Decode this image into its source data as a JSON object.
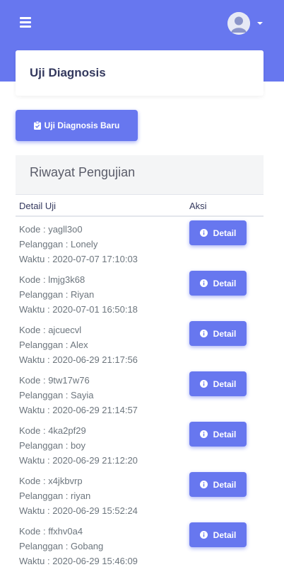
{
  "header": {
    "menu_icon": "hamburger-icon",
    "avatar_icon": "user-avatar-icon",
    "caret_icon": "caret-down-icon"
  },
  "page": {
    "title": "Uji Diagnosis"
  },
  "actions": {
    "new_label": "Uji Diagnosis Baru",
    "new_icon": "clipboard-check-icon"
  },
  "history": {
    "title": "Riwayat Pengujian",
    "columns": [
      "Detail Uji",
      "Aksi"
    ],
    "detail_label": "Detail",
    "detail_icon": "info-circle-icon",
    "rows": [
      {
        "kode": "Kode : yagll3o0",
        "pelanggan": "Pelanggan : Lonely",
        "waktu": "Waktu : 2020-07-07 17:10:03"
      },
      {
        "kode": "Kode : lmjg3k68",
        "pelanggan": "Pelanggan : Riyan",
        "waktu": "Waktu : 2020-07-01 16:50:18"
      },
      {
        "kode": "Kode : ajcuecvl",
        "pelanggan": "Pelanggan : Alex",
        "waktu": "Waktu : 2020-06-29 21:17:56"
      },
      {
        "kode": "Kode : 9tw17w76",
        "pelanggan": "Pelanggan : Sayia",
        "waktu": "Waktu : 2020-06-29 21:14:57"
      },
      {
        "kode": "Kode : 4ka2pf29",
        "pelanggan": "Pelanggan : boy",
        "waktu": "Waktu : 2020-06-29 21:12:20"
      },
      {
        "kode": "Kode : x4jkbvrp",
        "pelanggan": "Pelanggan : riyan",
        "waktu": "Waktu : 2020-06-29 15:52:24"
      },
      {
        "kode": "Kode : ffxhv0a4",
        "pelanggan": "Pelanggan : Gobang",
        "waktu": "Waktu : 2020-06-29 15:46:09"
      }
    ]
  },
  "colors": {
    "primary": "#6777ef",
    "background": "#f8f9fc",
    "text": "#6c757d"
  }
}
